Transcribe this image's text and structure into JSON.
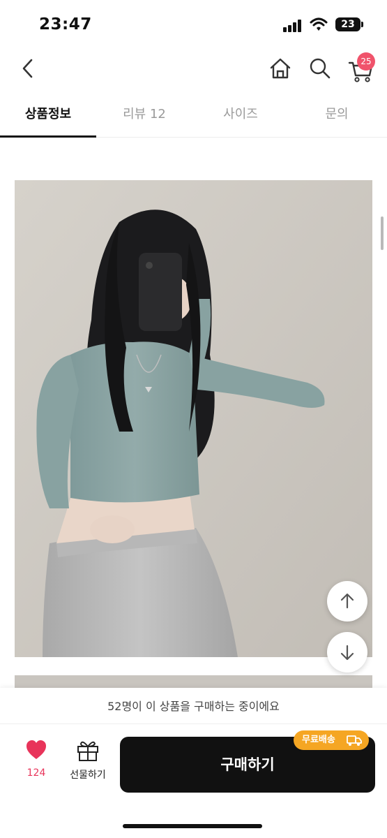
{
  "status_bar": {
    "time": "23:47",
    "battery": "23"
  },
  "header": {
    "cart_count": "25"
  },
  "tabs": [
    {
      "label": "상품정보",
      "active": true
    },
    {
      "label": "리뷰 12",
      "active": false
    },
    {
      "label": "사이즈",
      "active": false
    },
    {
      "label": "문의",
      "active": false
    }
  ],
  "notice": "52명이 이 상품을 구매하는 중이에요",
  "actions": {
    "like_count": "124",
    "gift_label": "선물하기",
    "buy_label": "구매하기",
    "free_shipping": "무료배송"
  },
  "colors": {
    "badge": "#f0536b",
    "buy_button": "#111111",
    "like": "#e8345a",
    "free_shipping": "#f5a623"
  },
  "icons": [
    "back-icon",
    "home-icon",
    "search-icon",
    "cart-icon",
    "arrow-up-icon",
    "arrow-down-icon",
    "heart-icon",
    "gift-icon",
    "truck-icon"
  ]
}
